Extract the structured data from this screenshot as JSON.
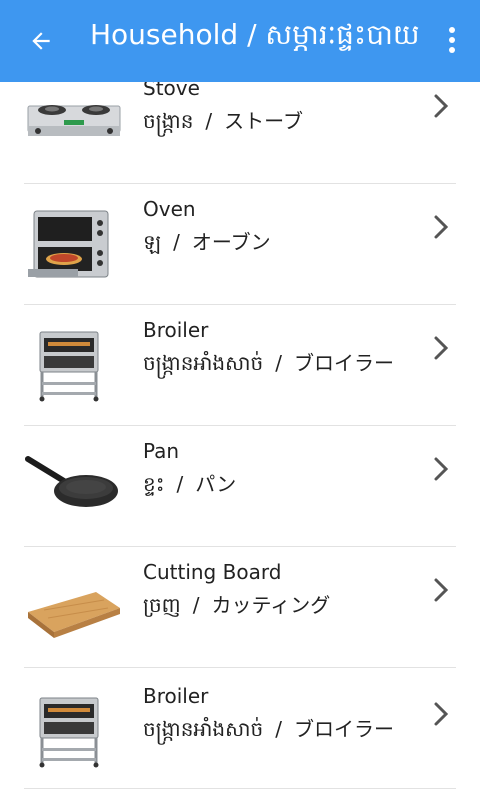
{
  "appbar": {
    "title": "Household / សម្ភារៈផ្ទះបាយ .",
    "back_icon": "arrow-left-icon",
    "more_icon": "more-vert-icon",
    "color": "#3e97f0"
  },
  "items": [
    {
      "name": "Stove",
      "khmer": "ចង្ក្រាន",
      "separator": "/",
      "japanese": "ストーブ",
      "icon": "stove-image"
    },
    {
      "name": "Oven",
      "khmer": "ឡ",
      "separator": "/",
      "japanese": "オーブン",
      "icon": "oven-image"
    },
    {
      "name": "Broiler",
      "khmer": "ចង្ក្រានអាំងសាច់",
      "separator": "/",
      "japanese": "ブロイラー",
      "icon": "broiler-image"
    },
    {
      "name": "Pan",
      "khmer": "ខ្ទះ",
      "separator": "/",
      "japanese": "パン",
      "icon": "pan-image"
    },
    {
      "name": "Cutting Board",
      "khmer": "ច្រញ",
      "separator": "/",
      "japanese": "カッティング",
      "icon": "cutting-board-image"
    },
    {
      "name": "Broiler",
      "khmer": "ចង្ក្រានអាំងសាច់",
      "separator": "/",
      "japanese": "ブロイラー",
      "icon": "broiler-image"
    }
  ]
}
